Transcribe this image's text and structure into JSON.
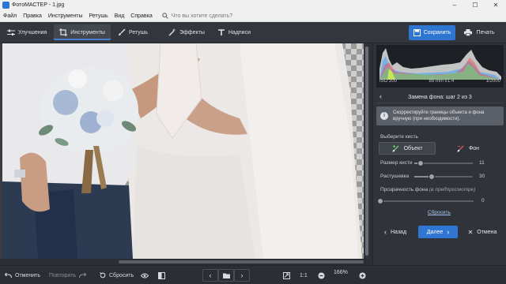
{
  "window": {
    "title": "ФотоМАСТЕР - 1.jpg",
    "controls": [
      "–",
      "☐",
      "✕"
    ]
  },
  "menu": {
    "items": [
      "Файл",
      "Правка",
      "Инструменты",
      "Ретушь",
      "Вид",
      "Справка"
    ],
    "search_placeholder": "Что вы хотите сделать?"
  },
  "toolbar": {
    "tabs": [
      {
        "label": "Улучшения",
        "icon": "sliders-icon",
        "active": false
      },
      {
        "label": "Инструменты",
        "icon": "crop-icon",
        "active": true
      },
      {
        "label": "Ретушь",
        "icon": "brush-icon",
        "active": false
      },
      {
        "label": "Эффекты",
        "icon": "magic-wand-icon",
        "active": false
      },
      {
        "label": "Надписи",
        "icon": "text-icon",
        "active": false
      }
    ],
    "save_label": "Сохранить",
    "print_label": "Печать"
  },
  "histogram": {
    "iso": "ISO 200",
    "focal": "85 mm f/1.4",
    "shutter": "1/2000"
  },
  "panel": {
    "step_title": "Замена фона: шаг 2 из 3",
    "hint": "Скорректируйте границы объекта и фона вручную (при необходимости).",
    "choose_brush_label": "Выберите кисть",
    "brush_object": "Объект",
    "brush_background": "Фон",
    "brush_size_label": "Размер кисти",
    "brush_size_value": "11",
    "feather_label": "Растушевка",
    "feather_value": "30",
    "opacity_label": "Прозрачность фона",
    "opacity_note": "(в предпросмотре)",
    "opacity_value": "0",
    "reset_link": "Сбросить",
    "back_label": "Назад",
    "next_label": "Далее",
    "cancel_label": "Отмена"
  },
  "bottombar": {
    "undo_label": "Отменить",
    "redo_label": "Повторить",
    "reset_label": "Сбросить",
    "ratio_label": "1:1",
    "zoom_value": "166%"
  },
  "sliders": {
    "brush_size": 0.11,
    "feather": 0.3,
    "opacity": 0.0
  },
  "colors": {
    "accent": "#2f75d2",
    "panel_bg": "#30343a",
    "toolbar_bg": "#33373d"
  }
}
